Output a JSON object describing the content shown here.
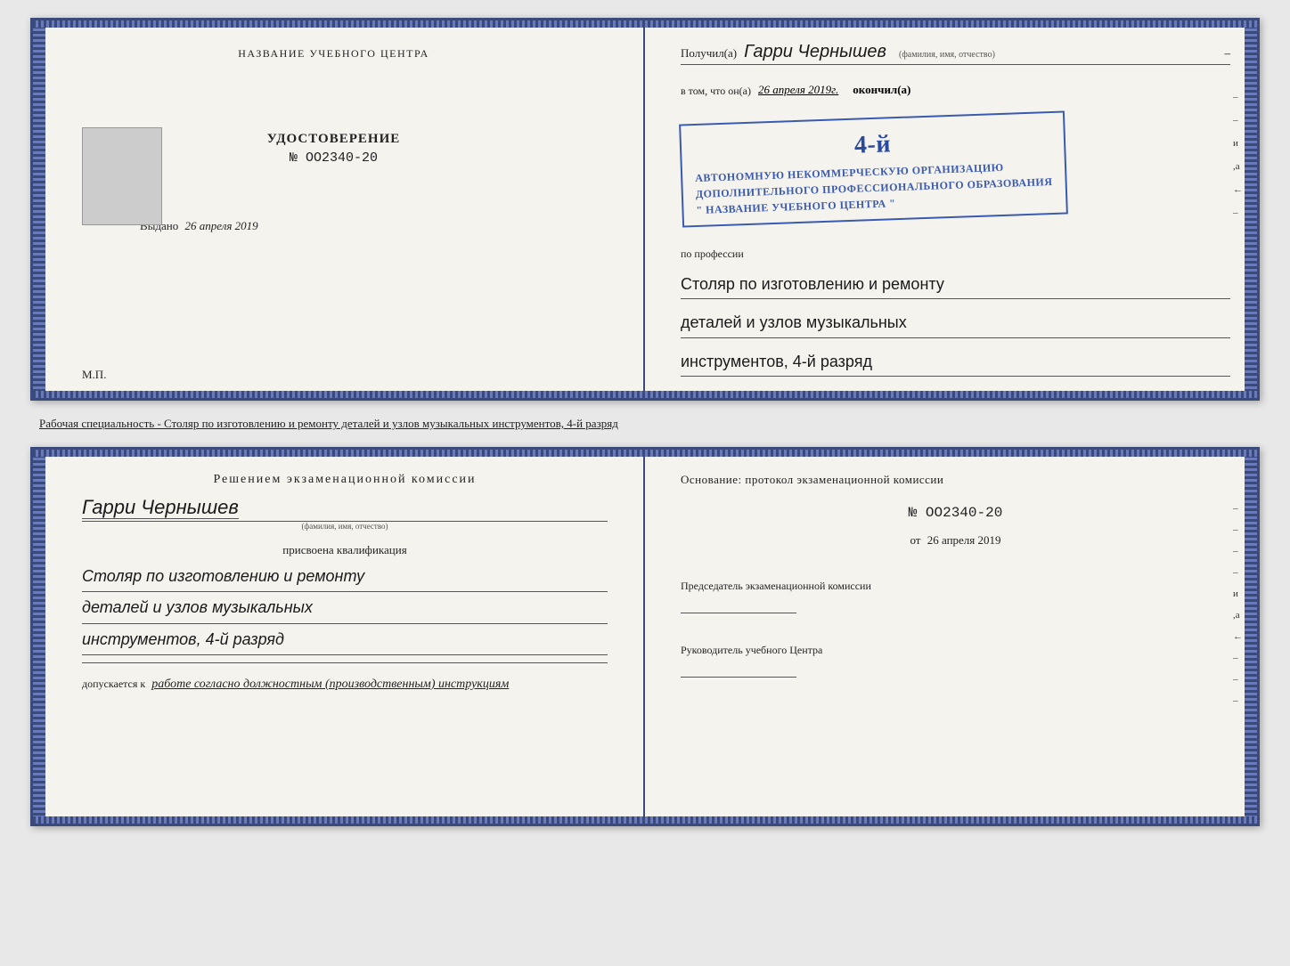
{
  "top_spread": {
    "left": {
      "heading": "НАЗВАНИЕ УЧЕБНОГО ЦЕНТРА",
      "certificate_title": "УДОСТОВЕРЕНИЕ",
      "certificate_number": "№ OO2340-20",
      "vydano_label": "Выдано",
      "vydano_date": "26 апреля 2019",
      "mp_label": "М.П."
    },
    "right": {
      "poluchil_label": "Получил(а)",
      "recipient_name": "Гарри Чернышев",
      "fio_label": "(фамилия, имя, отчество)",
      "vtom_prefix": "в том, что он(а)",
      "vtom_date": "26 апреля 2019г.",
      "okončil_label": "окончил(а)",
      "stamp_line1": "4-й",
      "stamp_line2": "АВТОНОМНУЮ НЕКОММЕРЧЕСКУЮ ОРГАНИЗАЦИЮ",
      "stamp_line3": "ДОПОЛНИТЕЛЬНОГО ПРОФЕССИОНАЛЬНОГО ОБРАЗОВАНИЯ",
      "stamp_line4": "\" НАЗВАНИЕ УЧЕБНОГО ЦЕНТРА \"",
      "po_professii_label": "по профессии",
      "profession_line1": "Столяр по изготовлению и ремонту",
      "profession_line2": "деталей и узлов музыкальных",
      "profession_line3": "инструментов, 4-й разряд",
      "right_labels": [
        "–",
        "–",
        "и",
        "а",
        "←",
        "–"
      ]
    }
  },
  "description": "Рабочая специальность - Столяр по изготовлению и ремонту деталей и узлов музыкальных инструментов, 4-й разряд",
  "bottom_spread": {
    "left": {
      "resheniem": "Решением экзаменационной комиссии",
      "name": "Гарри Чернышев",
      "fio_label": "(фамилия, имя, отчество)",
      "prisvoena": "присвоена квалификация",
      "qual_line1": "Столяр по изготовлению и ремонту",
      "qual_line2": "деталей и узлов музыкальных",
      "qual_line3": "инструментов, 4-й разряд",
      "dopusk_prefix": "допускается к",
      "dopusk_text": "работе согласно должностным (производственным) инструкциям"
    },
    "right": {
      "osnovanie": "Основание: протокол экзаменационной комиссии",
      "number": "№ OO2340-20",
      "ot_label": "от",
      "ot_date": "26 апреля 2019",
      "predsedatel": "Председатель экзаменационной комиссии",
      "rukovoditel": "Руководитель учебного Центра",
      "right_labels": [
        "–",
        "–",
        "–",
        "–",
        "и",
        "а",
        "←",
        "–",
        "–",
        "–"
      ]
    }
  }
}
